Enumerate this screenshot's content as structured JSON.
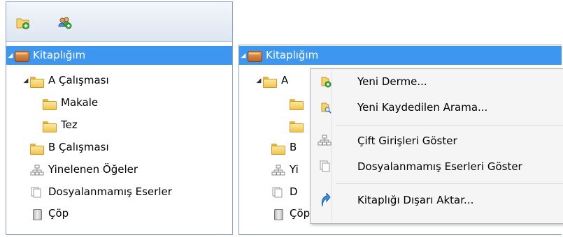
{
  "left_panel": {
    "tree": {
      "root": "Kitaplığım",
      "items": [
        {
          "label": "A Çalışması"
        },
        {
          "label": "Makale"
        },
        {
          "label": "Tez"
        },
        {
          "label": "B Çalışması"
        },
        {
          "label": "Yinelenen Öğeler"
        },
        {
          "label": "Dosyalanmamış Eserler"
        },
        {
          "label": "Çöp"
        }
      ]
    }
  },
  "right_panel": {
    "tree": {
      "root": "Kitaplığım",
      "items": [
        {
          "label": "A"
        },
        {
          "label": "B"
        },
        {
          "label": "Yi"
        },
        {
          "label": "D"
        },
        {
          "label": "Çöp"
        }
      ]
    }
  },
  "context_menu": {
    "items": [
      {
        "label": "Yeni Derme..."
      },
      {
        "label": "Yeni Kaydedilen Arama..."
      },
      {
        "label": "Çift Girişleri Göster"
      },
      {
        "label": "Dosyalanmamış Eserleri Göster"
      },
      {
        "label": "Kitaplığı Dışarı Aktar..."
      }
    ]
  },
  "colors": {
    "selection": "#3d97f0",
    "panel_border": "#8aa3c4",
    "menu_bg": "#f5f5f5"
  },
  "icons": {
    "toolbar": [
      "new-collection-icon",
      "new-group-icon"
    ]
  }
}
